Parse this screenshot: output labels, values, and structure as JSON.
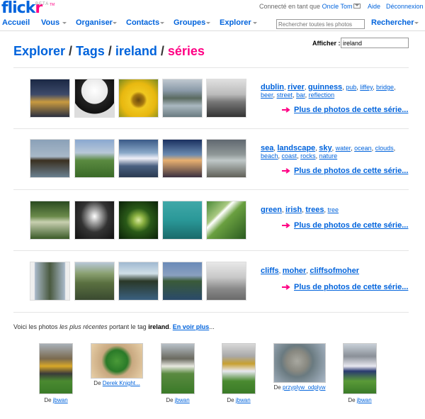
{
  "header": {
    "logo_part1": "flick",
    "logo_part2": "r",
    "beta_label": "BETA",
    "tm": "TM",
    "connected_prefix": "Connecté en tant que",
    "user": "Oncle Tom",
    "help": "Aide",
    "logout": "Déconnexion"
  },
  "nav": {
    "items": [
      {
        "label": "Accueil"
      },
      {
        "label": "Vous"
      },
      {
        "label": "Organiser"
      },
      {
        "label": "Contacts"
      },
      {
        "label": "Groupes"
      },
      {
        "label": "Explorer"
      }
    ],
    "search_placeholder": "Rechercher toutes les photos",
    "search_button": "Rechercher"
  },
  "title": {
    "explore": "Explorer",
    "tags": "Tags",
    "tag": "ireland",
    "series": "séries",
    "sep": "/"
  },
  "afficher": {
    "label": "Afficher :",
    "value": "ireland"
  },
  "series": [
    {
      "tags_line1": [
        {
          "text": "dublin",
          "big": true
        },
        {
          "text": "river",
          "big": true
        },
        {
          "text": "guinness",
          "big": true
        },
        {
          "text": "pub",
          "big": false
        },
        {
          "text": "liffey",
          "big": false
        },
        {
          "text": "bridge",
          "big": false
        }
      ],
      "tags_line2": [
        {
          "text": "beer",
          "big": false
        },
        {
          "text": "street",
          "big": false
        },
        {
          "text": "bar",
          "big": false
        },
        {
          "text": "reflection",
          "big": false
        }
      ],
      "more": "Plus de photos de cette série..."
    },
    {
      "tags_line1": [
        {
          "text": "sea",
          "big": true
        },
        {
          "text": "landscape",
          "big": true
        },
        {
          "text": "sky",
          "big": true
        },
        {
          "text": "water",
          "big": false
        },
        {
          "text": "ocean",
          "big": false
        },
        {
          "text": "clouds",
          "big": false
        }
      ],
      "tags_line2": [
        {
          "text": "beach",
          "big": false
        },
        {
          "text": "coast",
          "big": false
        },
        {
          "text": "rocks",
          "big": false
        },
        {
          "text": "nature",
          "big": false
        }
      ],
      "more": "Plus de photos de cette série..."
    },
    {
      "tags_line1": [
        {
          "text": "green",
          "big": true
        },
        {
          "text": "irish",
          "big": true
        },
        {
          "text": "trees",
          "big": true
        },
        {
          "text": "tree",
          "big": false
        }
      ],
      "tags_line2": [],
      "more": "Plus de photos de cette série..."
    },
    {
      "tags_line1": [
        {
          "text": "cliffs",
          "big": true
        },
        {
          "text": "moher",
          "big": true
        },
        {
          "text": "cliffsofmoher",
          "big": true
        }
      ],
      "tags_line2": [],
      "more": "Plus de photos de cette série..."
    }
  ],
  "recent": {
    "prefix": "Voici les photos",
    "emph": "les plus récentes",
    "middle": "portant le tag",
    "tag": "ireland",
    "colon": ".",
    "see_more": "En voir plus",
    "ellipsis": "...",
    "by": "De",
    "photos": [
      {
        "author": "jbwan"
      },
      {
        "author": "Derek Knight..."
      },
      {
        "author": "jbwan"
      },
      {
        "author": "jbwan"
      },
      {
        "author": "przyplyw_odplyw"
      },
      {
        "author": "jbwan"
      }
    ]
  },
  "colors": {
    "brand_blue": "#0063dc",
    "brand_pink": "#ff0084"
  }
}
